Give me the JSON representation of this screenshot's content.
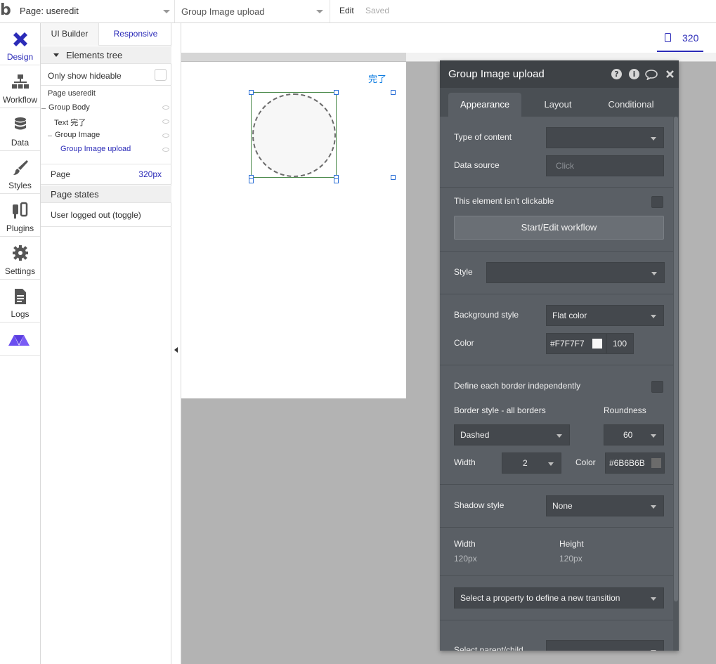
{
  "topbar": {
    "logo": "b",
    "page_select": "Page: useredit",
    "element_select": "Group Image upload",
    "edit": "Edit",
    "saved": "Saved"
  },
  "nav": [
    {
      "label": "Design",
      "icon": "design-icon"
    },
    {
      "label": "Workflow",
      "icon": "workflow-icon"
    },
    {
      "label": "Data",
      "icon": "database-icon"
    },
    {
      "label": "Styles",
      "icon": "brush-icon"
    },
    {
      "label": "Plugins",
      "icon": "plug-icon"
    },
    {
      "label": "Settings",
      "icon": "gear-icon"
    },
    {
      "label": "Logs",
      "icon": "document-icon"
    }
  ],
  "panel": {
    "tab_ui_builder": "UI Builder",
    "tab_responsive": "Responsive",
    "elements_tree": "Elements tree",
    "only_show_hideable": "Only show hideable",
    "tree": [
      "Page useredit",
      "Group Body",
      "Text 完了",
      "Group Image",
      "Group Image upload"
    ],
    "page_label": "Page",
    "page_value": "320px",
    "page_states": "Page states",
    "state_item": "User logged out (toggle)"
  },
  "canvas": {
    "device_width": "320",
    "done_text": "完了"
  },
  "editor": {
    "title": "Group Image upload",
    "tabs": [
      "Appearance",
      "Layout",
      "Conditional"
    ],
    "type_of_content": "Type of content",
    "type_of_content_value": "",
    "data_source": "Data source",
    "data_source_placeholder": "Click",
    "not_clickable": "This element isn't clickable",
    "workflow_btn": "Start/Edit workflow",
    "style": "Style",
    "style_value": "",
    "background_style": "Background style",
    "background_style_value": "Flat color",
    "color": "Color",
    "bg_color_hex": "#F7F7F7",
    "bg_opacity": "100",
    "border_independent": "Define each border independently",
    "border_style_all": "Border style - all borders",
    "roundness": "Roundness",
    "border_style_value": "Dashed",
    "roundness_value": "60",
    "width": "Width",
    "border_width_value": "2",
    "border_color_label": "Color",
    "border_color_hex": "#6B6B6B",
    "shadow_style": "Shadow style",
    "shadow_style_value": "None",
    "width_label": "Width",
    "width_value": "120px",
    "height_label": "Height",
    "height_value": "120px",
    "transition_value": "Select a property to define a new transition",
    "select_parent_child": "Select parent/child"
  },
  "colors": {
    "accent": "#2b2bb8",
    "bg_swatch": "#F7F7F7",
    "border_swatch": "#6B6B6B"
  }
}
